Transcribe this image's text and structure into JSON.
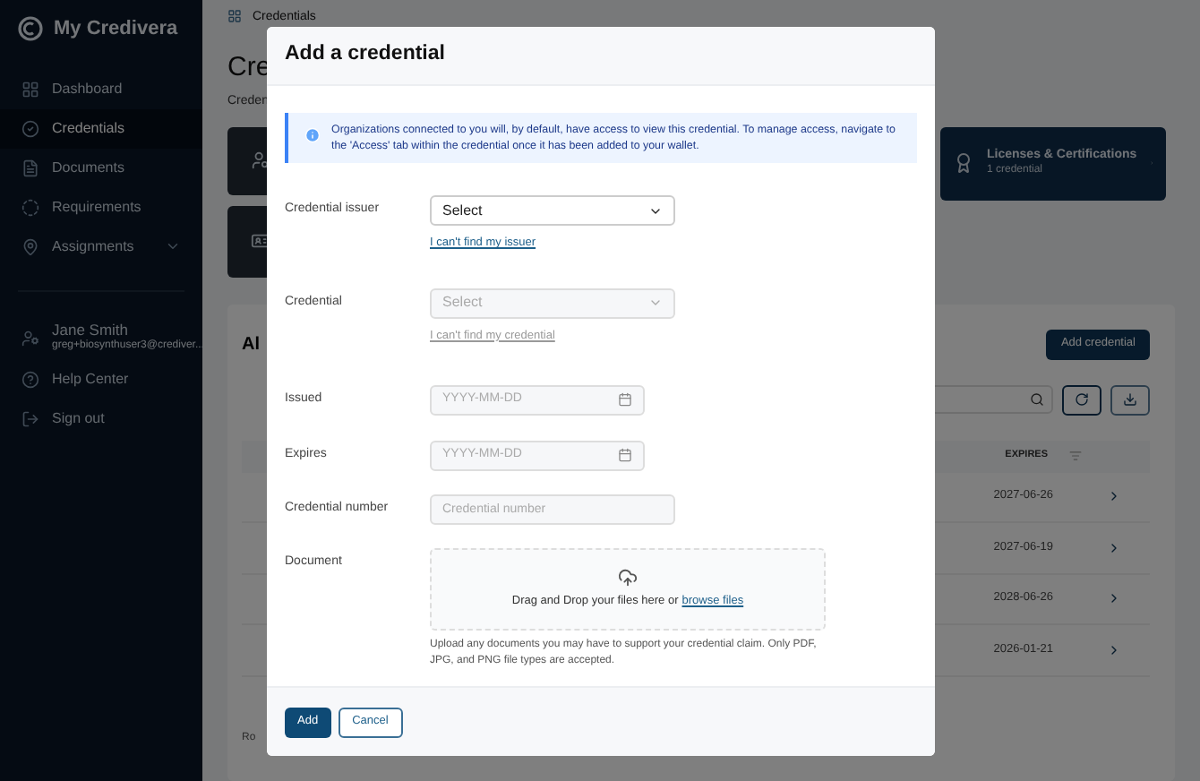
{
  "sidebar": {
    "brand": "My Credivera",
    "items": [
      {
        "label": "Dashboard",
        "selected": false,
        "kind": "link"
      },
      {
        "label": "Credentials",
        "selected": true,
        "kind": "link"
      },
      {
        "label": "Documents",
        "selected": false,
        "kind": "link"
      },
      {
        "label": "Requirements",
        "selected": false,
        "kind": "link"
      },
      {
        "label": "Assignments",
        "selected": false,
        "kind": "group"
      }
    ],
    "user": {
      "name": "Jane Smith",
      "email": "greg+biosynthuser3@crediver..."
    },
    "footer_items": [
      {
        "label": "Help Center"
      },
      {
        "label": "Sign out"
      }
    ]
  },
  "page": {
    "breadcrumb": "Credentials",
    "title": "Cre",
    "subtitle": "Creden",
    "category_card": {
      "title": "Licenses & Certifications",
      "count": "1 credential"
    },
    "panel": {
      "heading": "Al",
      "add_button": "Add credential",
      "column": "EXPIRES",
      "rows": [
        {
          "expires": "2027-06-26"
        },
        {
          "expires": "2027-06-19"
        },
        {
          "expires": "2028-06-26"
        },
        {
          "expires": "2026-01-21"
        }
      ],
      "footer": "Ro"
    }
  },
  "modal": {
    "title": "Add a credential",
    "notice": "Organizations connected to you will, by default, have access to view this credential. To manage access, navigate to the 'Access' tab within the credential once it has been added to your wallet.",
    "fields": [
      {
        "kind": "select",
        "label": "Credential issuer",
        "value": "Select",
        "disabled": false,
        "link": "I can't find my issuer"
      },
      {
        "kind": "select",
        "label": "Credential",
        "value": "Select",
        "disabled": true,
        "link": "I can't find my credential"
      },
      {
        "kind": "date",
        "label": "Issued",
        "placeholder": "YYYY-MM-DD"
      },
      {
        "kind": "date",
        "label": "Expires",
        "placeholder": "YYYY-MM-DD"
      },
      {
        "kind": "text",
        "label": "Credential number",
        "placeholder": "Credential number"
      },
      {
        "kind": "file",
        "label": "Document",
        "prompt": "Drag and Drop your files here or",
        "link": "browse files",
        "help": "Upload any documents you may have to support your credential claim. Only PDF, JPG, and PNG file types are accepted."
      }
    ],
    "buttons": [
      {
        "label": "Add",
        "kind": "primary"
      },
      {
        "label": "Cancel",
        "kind": "secondary"
      }
    ]
  }
}
